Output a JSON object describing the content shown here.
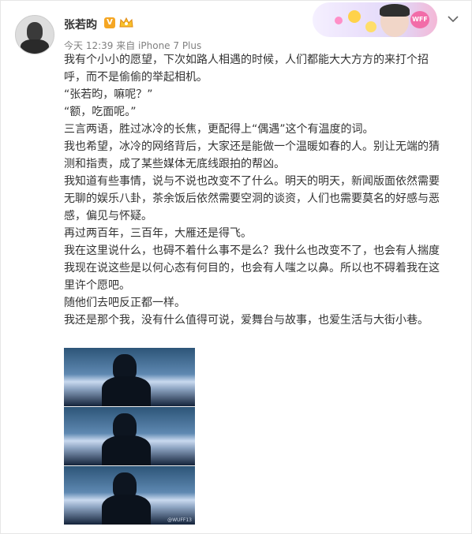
{
  "post": {
    "user_name": "张若昀",
    "verified_badge": "V",
    "time": "今天 12:39",
    "source": "来自 iPhone 7 Plus",
    "paragraphs": [
      "我有个小小的愿望，下次如路人相遇的时候，人们都能大大方方的来打个招呼，而不是偷偷的举起相机。",
      "“张若昀，嘛呢？”",
      "“额，吃面呢。”",
      "三言两语，胜过冰冷的长焦，更配得上“偶遇”这个有温度的词。",
      "我也希望，冰冷的网络背后，大家还是能做一个温暖如春的人。别让无端的猜测和指责，成了某些媒体无底线跟拍的帮凶。",
      "我知道有些事情，说与不说也改变不了什么。明天的明天，新闻版面依然需要无聊的娱乐八卦，茶余饭后依然需要空洞的谈资，人们也需要莫名的好感与恶感，偏见与怀疑。",
      "再过两百年，三百年，大雁还是得飞。",
      "我在这里说什么，也碍不着什么事不是么？我什么也改变不了，也会有人揣度我现在说这些是以何心态有何目的，也会有人嗤之以鼻。所以也不碍着我在这里许个愿吧。",
      "随他们去吧反正都一样。",
      "我还是那个我，没有什么值得可说，爱舞台与故事，也爱生活与大街小巷。"
    ],
    "photo_watermark": "@WUFF13",
    "banner_badge": "WFF"
  },
  "icons": {
    "verified": "verified-v-icon",
    "member": "crown-member-icon",
    "menu": "chevron-down-icon"
  },
  "colors": {
    "verified_badge": "#f5a623",
    "meta_text": "#808080",
    "body_text": "#333333"
  }
}
